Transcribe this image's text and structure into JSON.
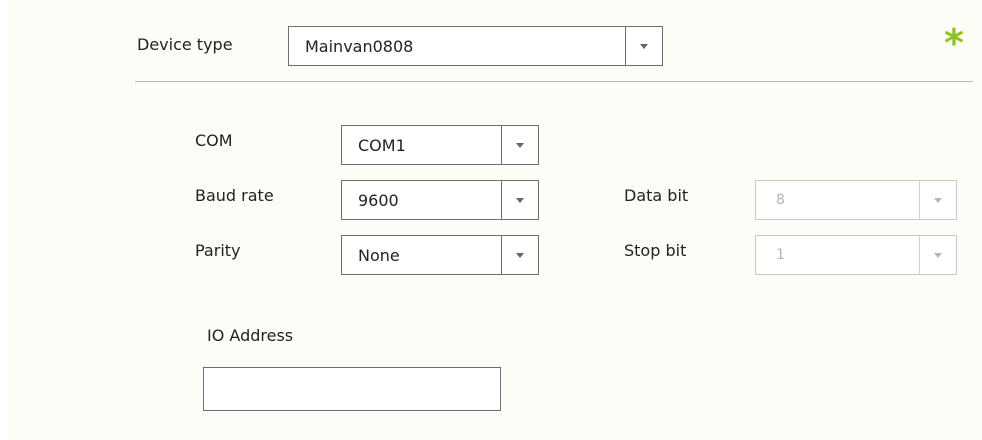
{
  "device_type": {
    "label": "Device type",
    "value": "Mainvan0808"
  },
  "required_marker": {
    "symbol": "*",
    "color": "#8dc21f"
  },
  "com": {
    "label": "COM",
    "value": "COM1"
  },
  "baud_rate": {
    "label": "Baud rate",
    "value": "9600"
  },
  "parity": {
    "label": "Parity",
    "value": "None"
  },
  "data_bit": {
    "label": "Data bit",
    "value": "8",
    "disabled": true
  },
  "stop_bit": {
    "label": "Stop bit",
    "value": "1",
    "disabled": true
  },
  "io_address": {
    "label": "IO Address",
    "value": ""
  },
  "icons": {
    "dropdown": "chevron-down-icon",
    "required": "asterisk-icon"
  }
}
